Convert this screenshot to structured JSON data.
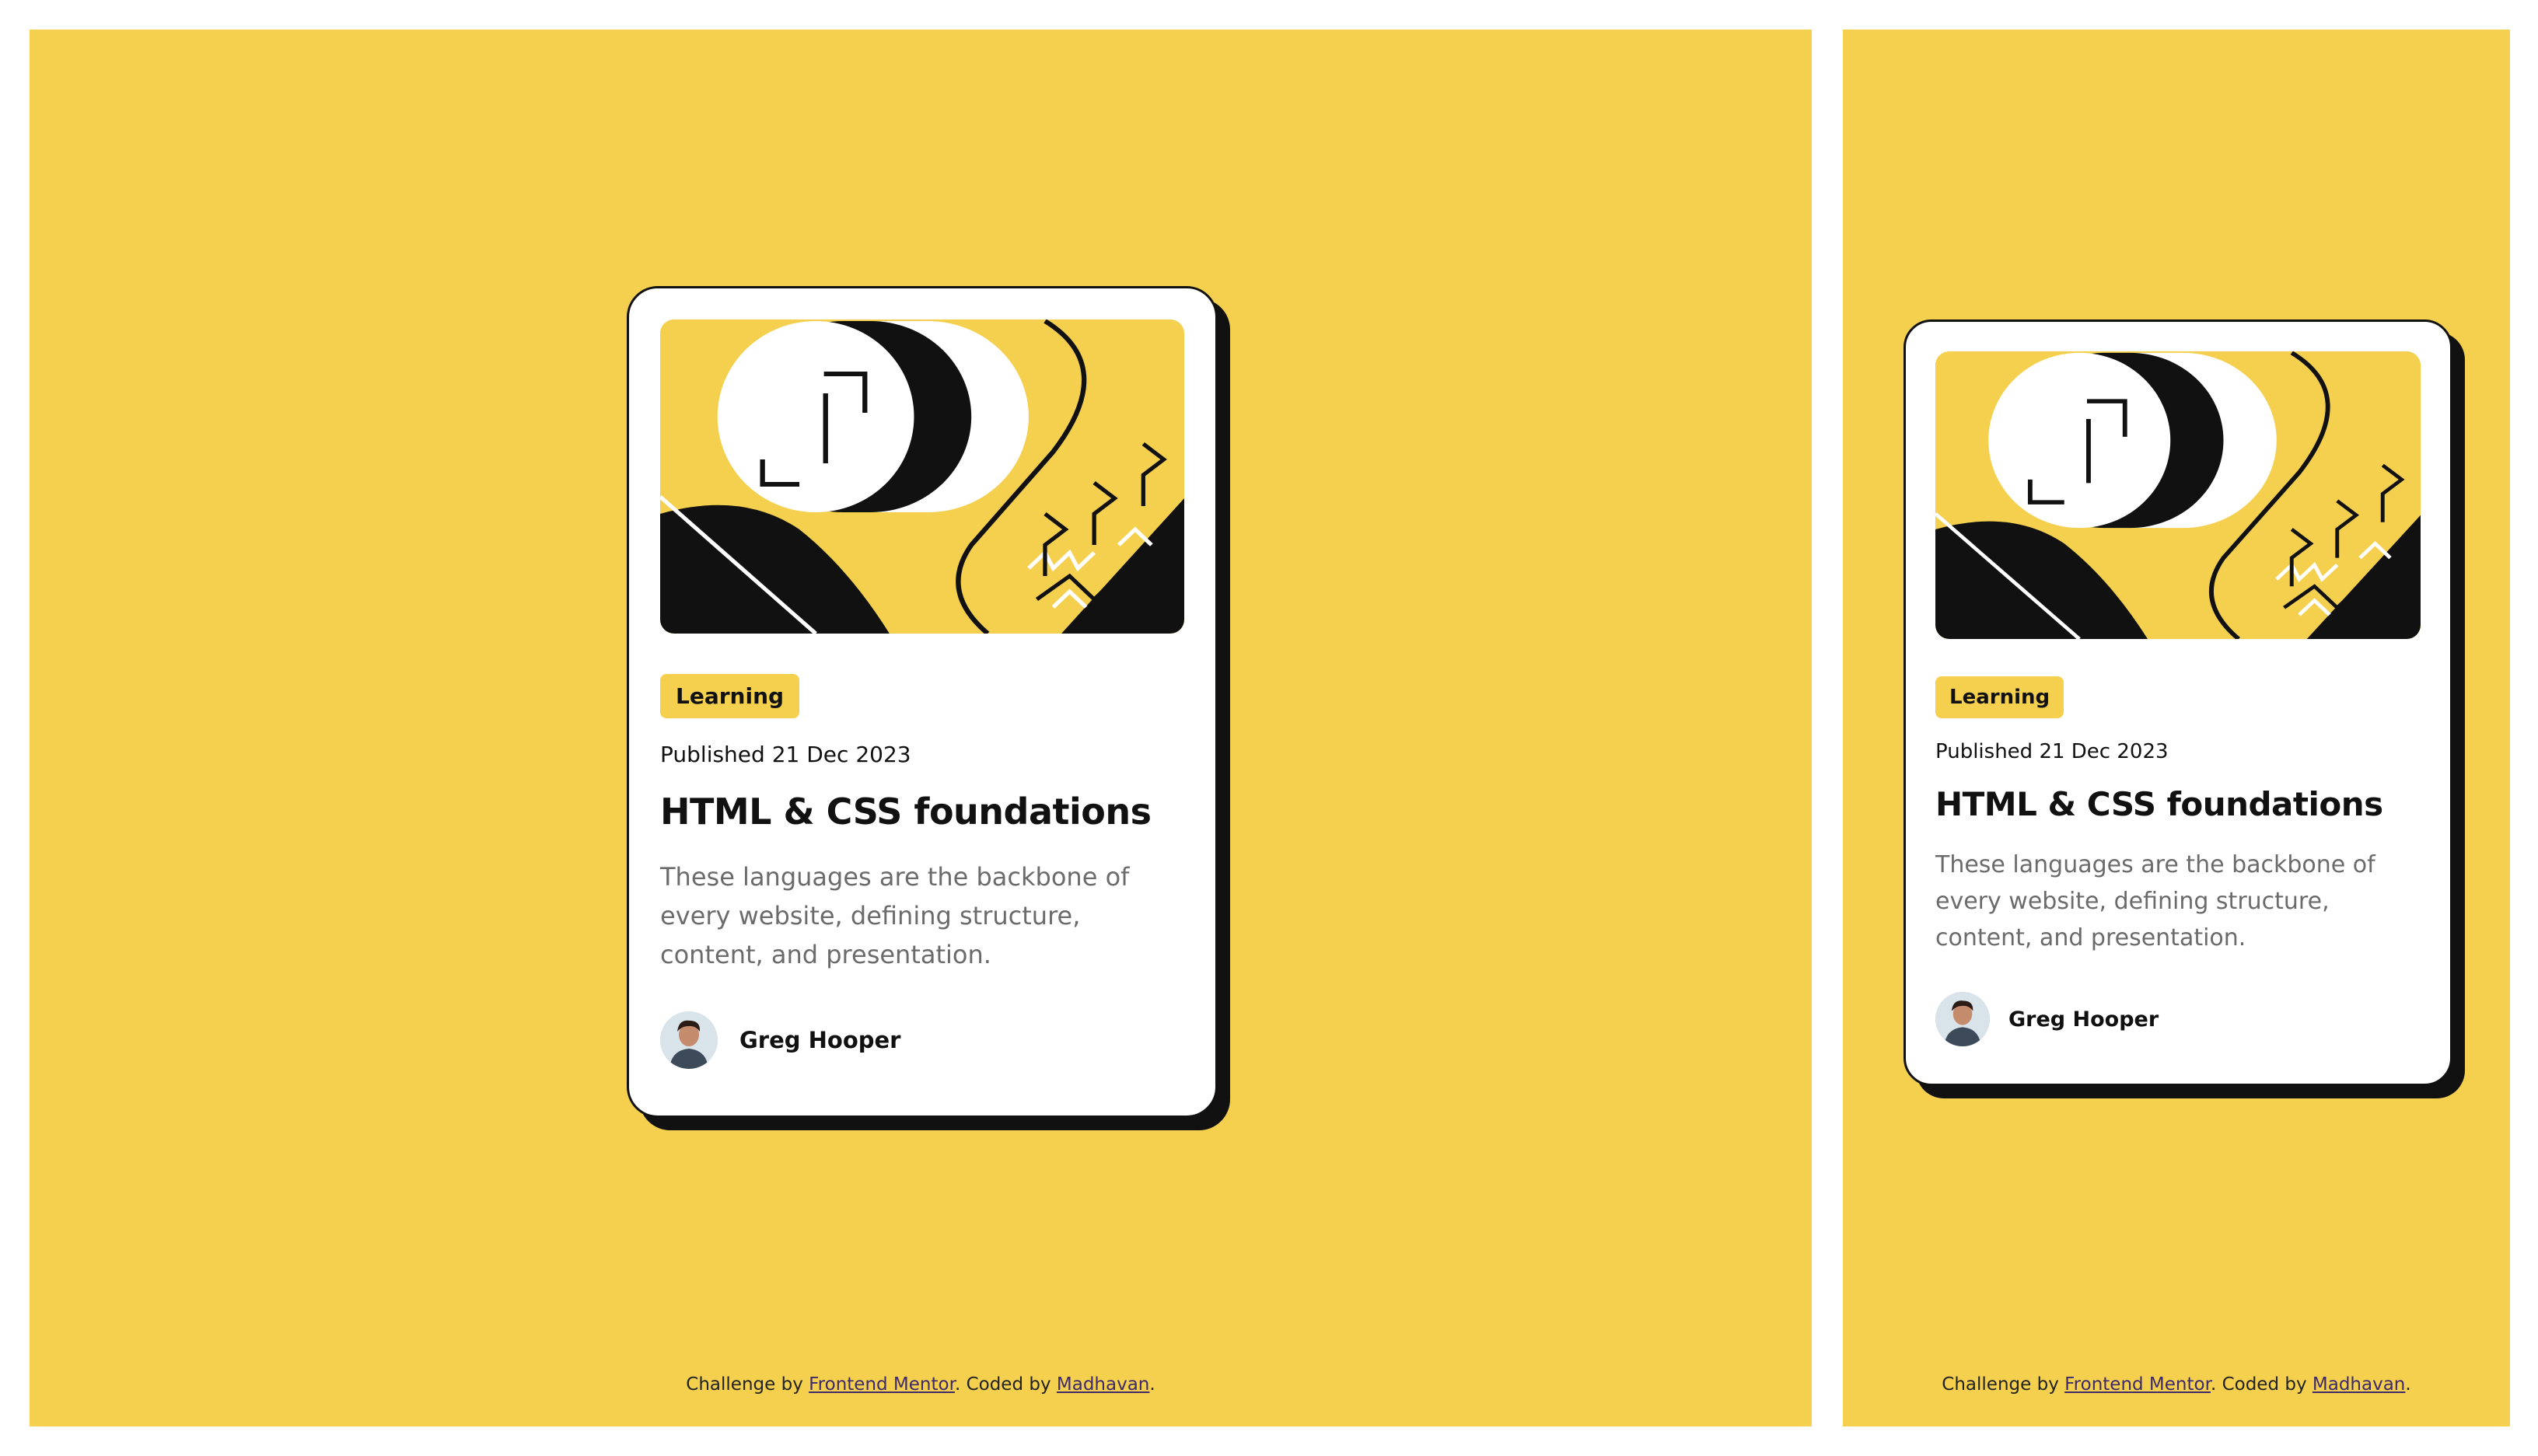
{
  "colors": {
    "background": "#f4d04e",
    "card": "#ffffff",
    "ink": "#111111",
    "muted": "#6b6b6b",
    "link": "#3e2a6b"
  },
  "card": {
    "illustration_icon": "abstract-illustration",
    "tag": "Learning",
    "published": "Published 21 Dec 2023",
    "title": "HTML & CSS foundations",
    "description": "These languages are the backbone of every website, defining structure, content, and presentation.",
    "author": {
      "avatar_icon": "avatar-portrait",
      "name": "Greg Hooper"
    }
  },
  "attribution": {
    "prefix": "Challenge by ",
    "link1": "Frontend Mentor",
    "middle": ". Coded by ",
    "link2": "Madhavan",
    "suffix": "."
  }
}
